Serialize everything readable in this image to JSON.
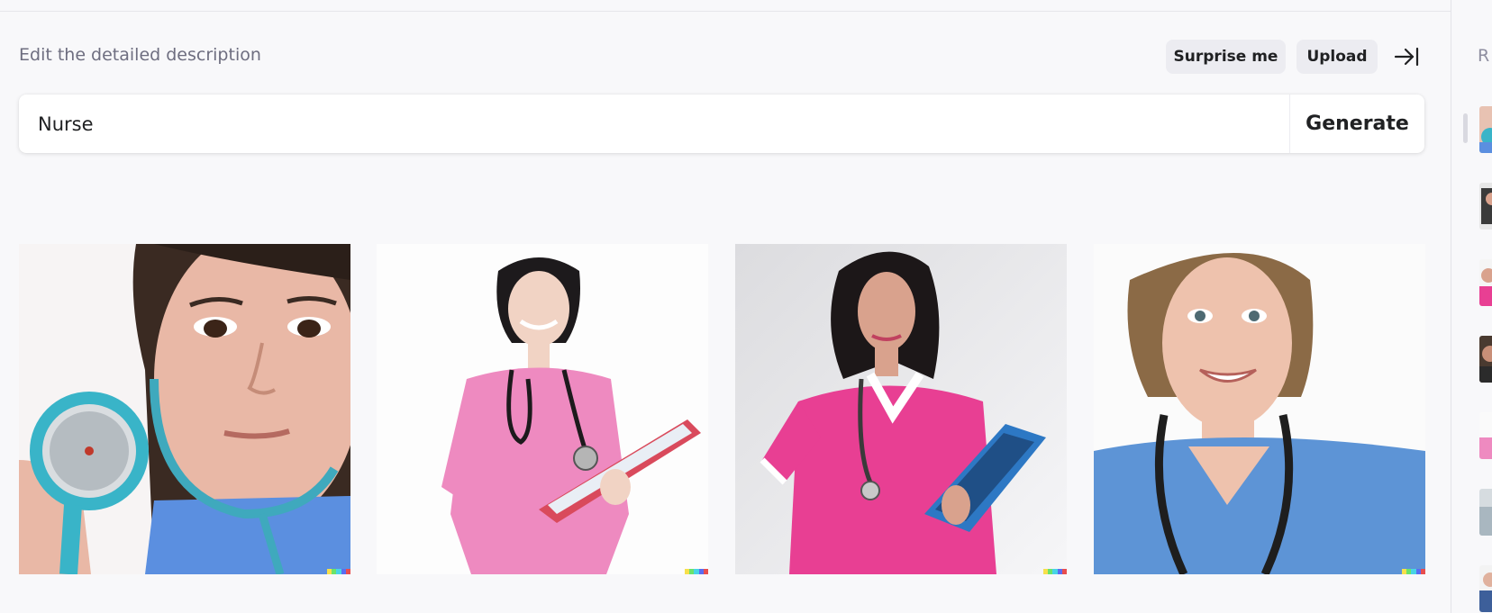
{
  "header": {
    "prompt_label": "Edit the detailed description",
    "surprise_label": "Surprise me",
    "upload_label": "Upload"
  },
  "prompt": {
    "value": "Nurse",
    "generate_label": "Generate"
  },
  "history": {
    "title": "R"
  },
  "colors": {
    "background": "#f8f8fa",
    "button_bg": "#ececf1",
    "text": "#202123",
    "muted_text": "#6e6e80",
    "signature": [
      "#f7e04b",
      "#6be36a",
      "#48d4e6",
      "#5a6df2",
      "#e84e4e"
    ]
  },
  "icons": {
    "collapse": "arrow-right-to-bar-icon"
  }
}
